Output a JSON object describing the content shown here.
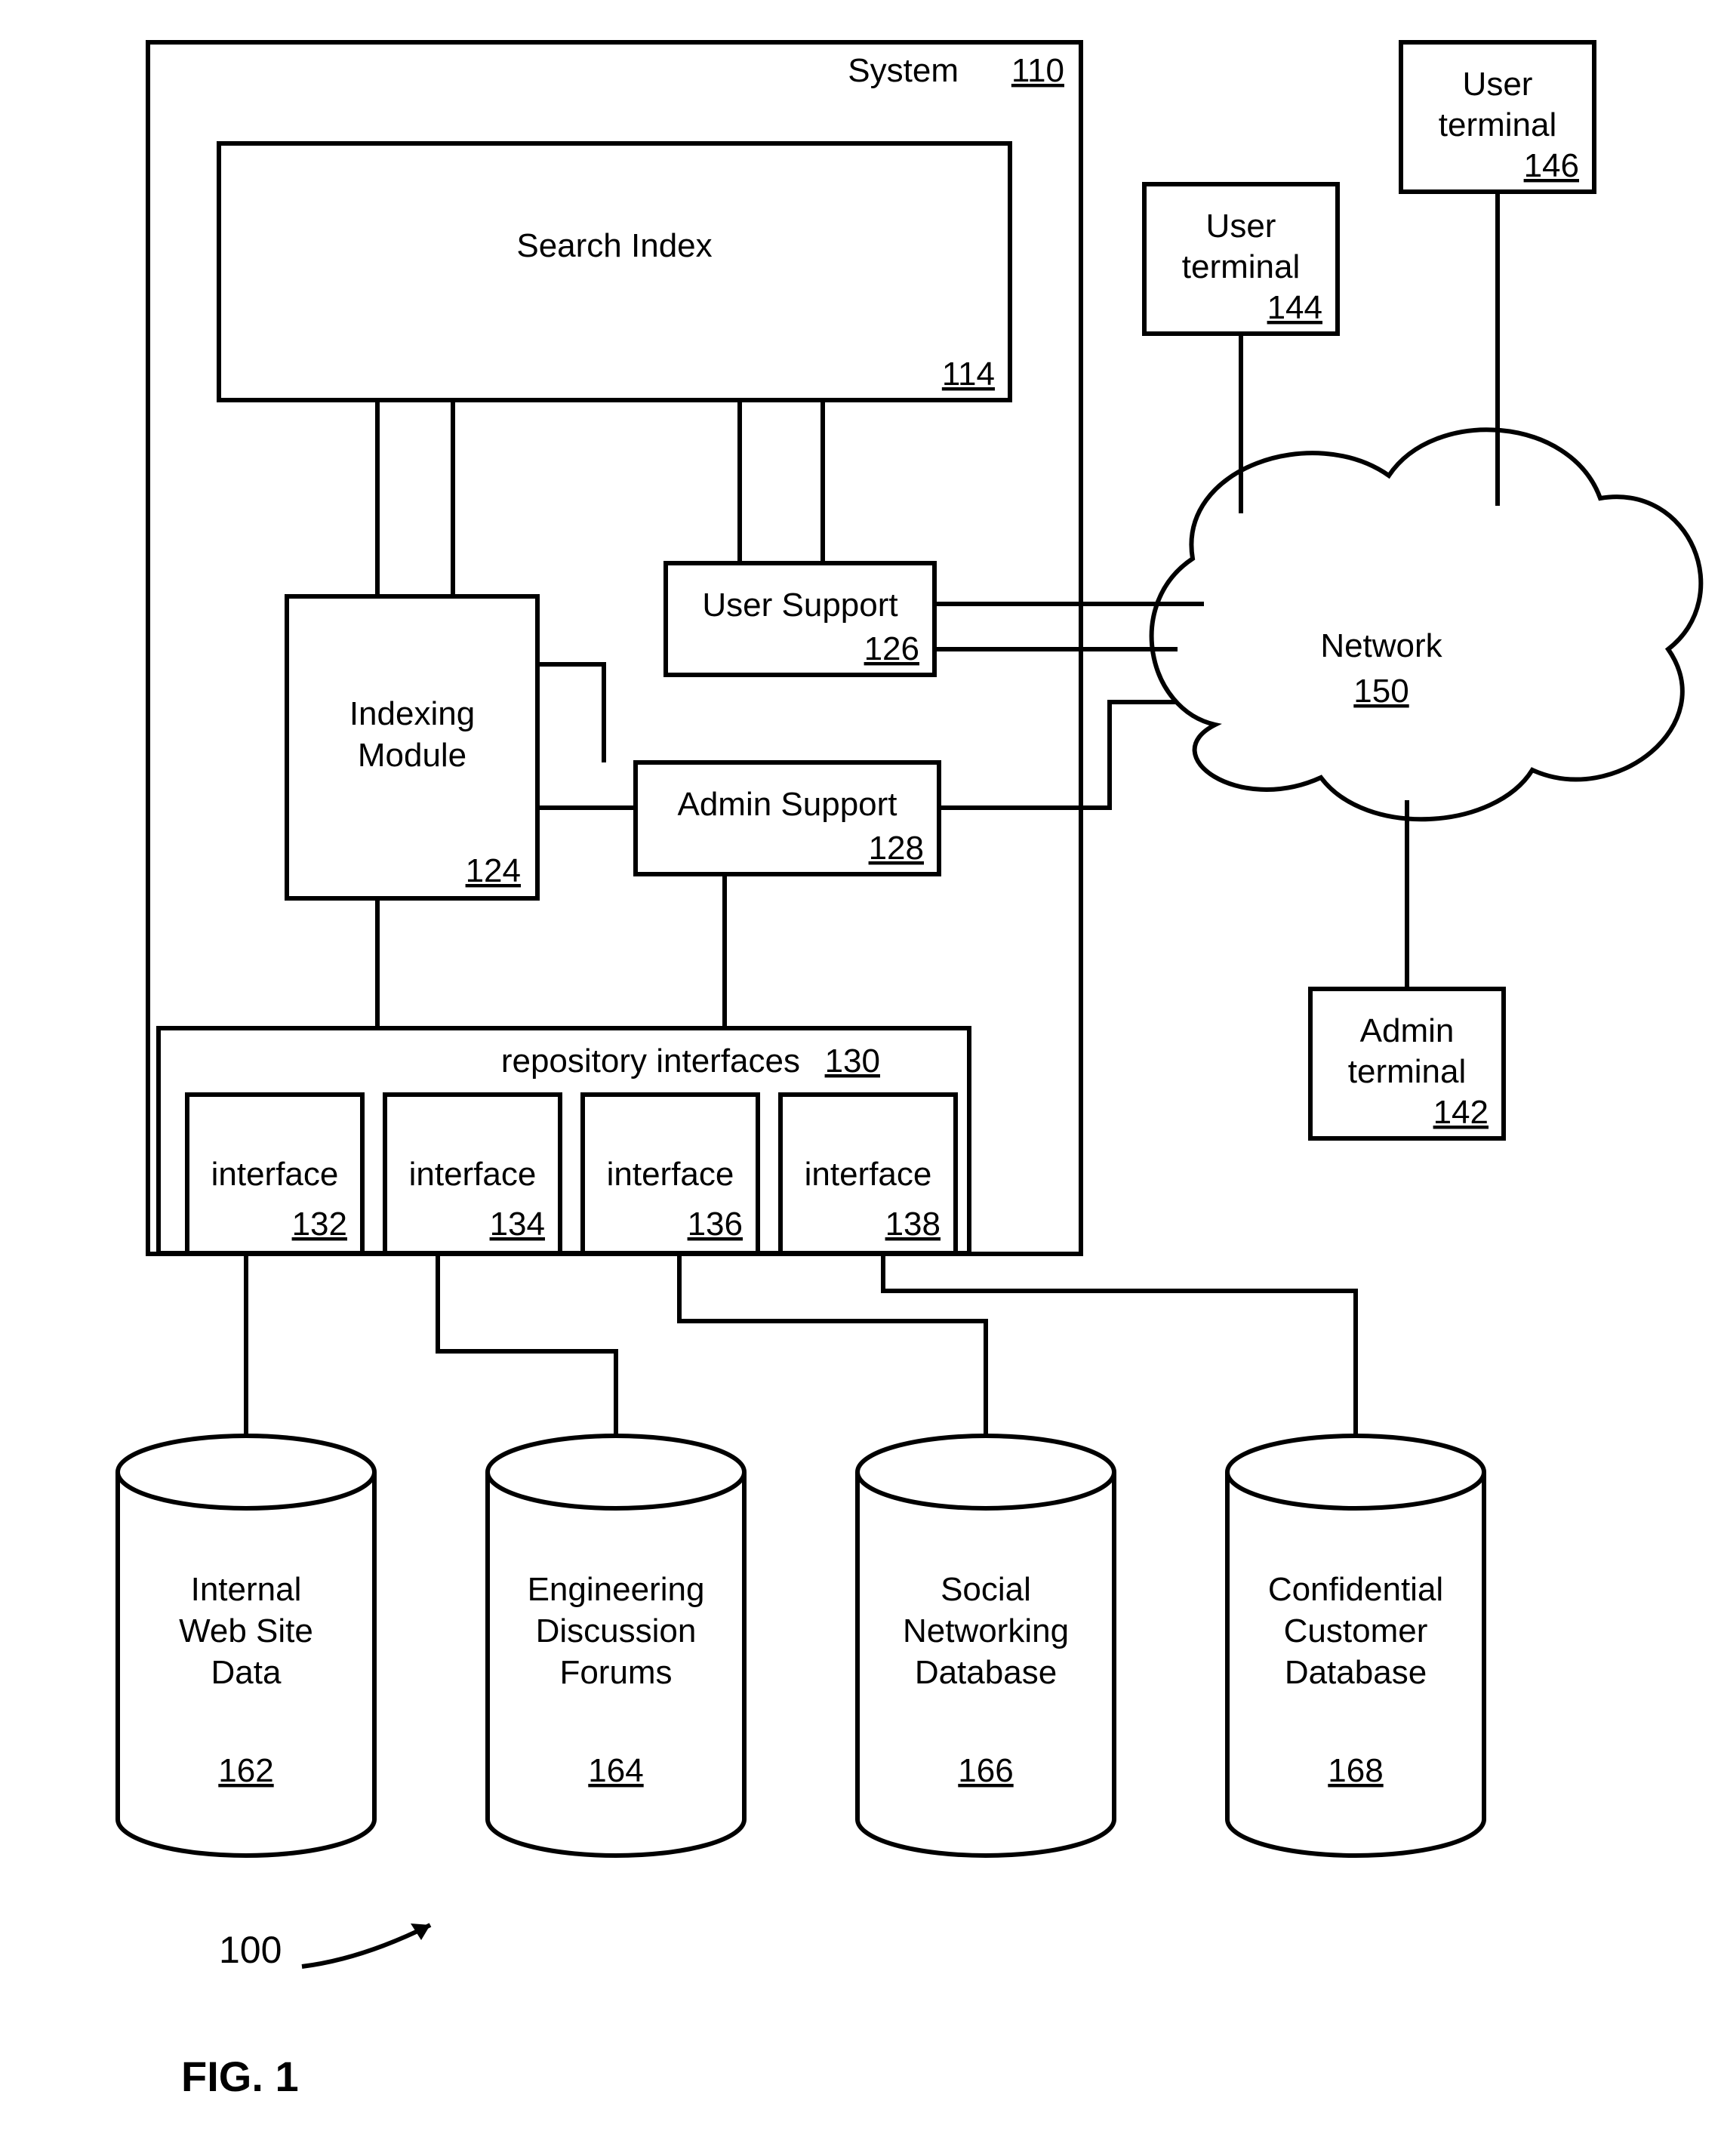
{
  "figure": {
    "number_label": "100",
    "caption": "FIG. 1"
  },
  "system": {
    "label": "System",
    "ref": "110"
  },
  "search_index": {
    "label": "Search Index",
    "ref": "114"
  },
  "indexing_module": {
    "label_l1": "Indexing",
    "label_l2": "Module",
    "ref": "124"
  },
  "user_support": {
    "label": "User Support",
    "ref": "126"
  },
  "admin_support": {
    "label": "Admin Support",
    "ref": "128"
  },
  "repo_interfaces": {
    "label": "repository interfaces",
    "ref": "130"
  },
  "iface1": {
    "label": "interface",
    "ref": "132"
  },
  "iface2": {
    "label": "interface",
    "ref": "134"
  },
  "iface3": {
    "label": "interface",
    "ref": "136"
  },
  "iface4": {
    "label": "interface",
    "ref": "138"
  },
  "admin_terminal": {
    "label_l1": "Admin",
    "label_l2": "terminal",
    "ref": "142"
  },
  "user_terminal_1": {
    "label_l1": "User",
    "label_l2": "terminal",
    "ref": "144"
  },
  "user_terminal_2": {
    "label_l1": "User",
    "label_l2": "terminal",
    "ref": "146"
  },
  "network": {
    "label": "Network",
    "ref": "150"
  },
  "db1": {
    "l1": "Internal",
    "l2": "Web Site",
    "l3": "Data",
    "ref": "162"
  },
  "db2": {
    "l1": "Engineering",
    "l2": "Discussion",
    "l3": "Forums",
    "ref": "164"
  },
  "db3": {
    "l1": "Social",
    "l2": "Networking",
    "l3": "Database",
    "ref": "166"
  },
  "db4": {
    "l1": "Confidential",
    "l2": "Customer",
    "l3": "Database",
    "ref": "168"
  }
}
